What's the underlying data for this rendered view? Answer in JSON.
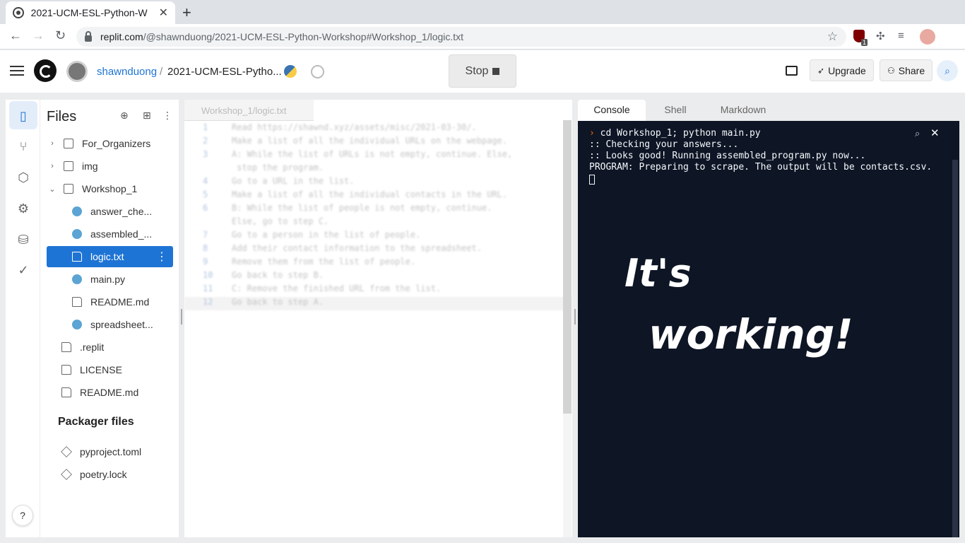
{
  "browser": {
    "tab_title": "2021-UCM-ESL-Python-W",
    "url_host": "replit.com",
    "url_path": "/@shawnduong/2021-UCM-ESL-Python-Workshop#Workshop_1/logic.txt",
    "ext_badge": "1"
  },
  "header": {
    "username": "shawnduong",
    "separator": "/",
    "repl_name": "2021-UCM-ESL-Pytho...",
    "stop_label": "Stop",
    "upgrade_label": "Upgrade",
    "share_label": "Share"
  },
  "files": {
    "title": "Files",
    "tree": [
      {
        "name": "For_Organizers",
        "type": "folder"
      },
      {
        "name": "img",
        "type": "folder"
      },
      {
        "name": "Workshop_1",
        "type": "folder"
      },
      {
        "name": "answer_che...",
        "type": "python"
      },
      {
        "name": "assembled_...",
        "type": "python"
      },
      {
        "name": "logic.txt",
        "type": "file"
      },
      {
        "name": "main.py",
        "type": "python"
      },
      {
        "name": "README.md",
        "type": "file"
      },
      {
        "name": "spreadsheet...",
        "type": "python"
      },
      {
        "name": ".replit",
        "type": "file"
      },
      {
        "name": "LICENSE",
        "type": "file"
      },
      {
        "name": "README.md",
        "type": "file"
      }
    ],
    "packager_title": "Packager files",
    "packager": [
      {
        "name": "pyproject.toml"
      },
      {
        "name": "poetry.lock"
      }
    ],
    "help_label": "?"
  },
  "editor": {
    "tab_label": "Workshop_1/logic.txt",
    "lines": [
      {
        "n": "1",
        "text": "Read https://shawnd.xyz/assets/misc/2021-03-30/."
      },
      {
        "n": "2",
        "text": "Make a list of all the individual URLs on the webpage."
      },
      {
        "n": "3",
        "text": "A: While the list of URLs is not empty, continue. Else,"
      },
      {
        "n": "",
        "text": " stop the program."
      },
      {
        "n": "4",
        "text": "Go to a URL in the list."
      },
      {
        "n": "5",
        "text": "Make a list of all the individual contacts in the URL."
      },
      {
        "n": "6",
        "text": "B: While the list of people is not empty, continue."
      },
      {
        "n": "",
        "text": "Else, go to step C."
      },
      {
        "n": "7",
        "text": "Go to a person in the list of people."
      },
      {
        "n": "8",
        "text": "Add their contact information to the spreadsheet."
      },
      {
        "n": "9",
        "text": "Remove them from the list of people."
      },
      {
        "n": "10",
        "text": "Go back to step B."
      },
      {
        "n": "11",
        "text": "C: Remove the finished URL from the list."
      },
      {
        "n": "12",
        "text": "Go back to step A."
      }
    ]
  },
  "console": {
    "tabs": [
      "Console",
      "Shell",
      "Markdown"
    ],
    "prompt_symbol": "›",
    "command": "cd Workshop_1; python main.py",
    "output": [
      ":: Checking your answers...",
      ":: Looks good! Running assembled_program.py now...",
      "PROGRAM: Preparing to scrape. The output will be contacts.csv."
    ],
    "handwriting_line1": "It's",
    "handwriting_line2": "working!"
  }
}
